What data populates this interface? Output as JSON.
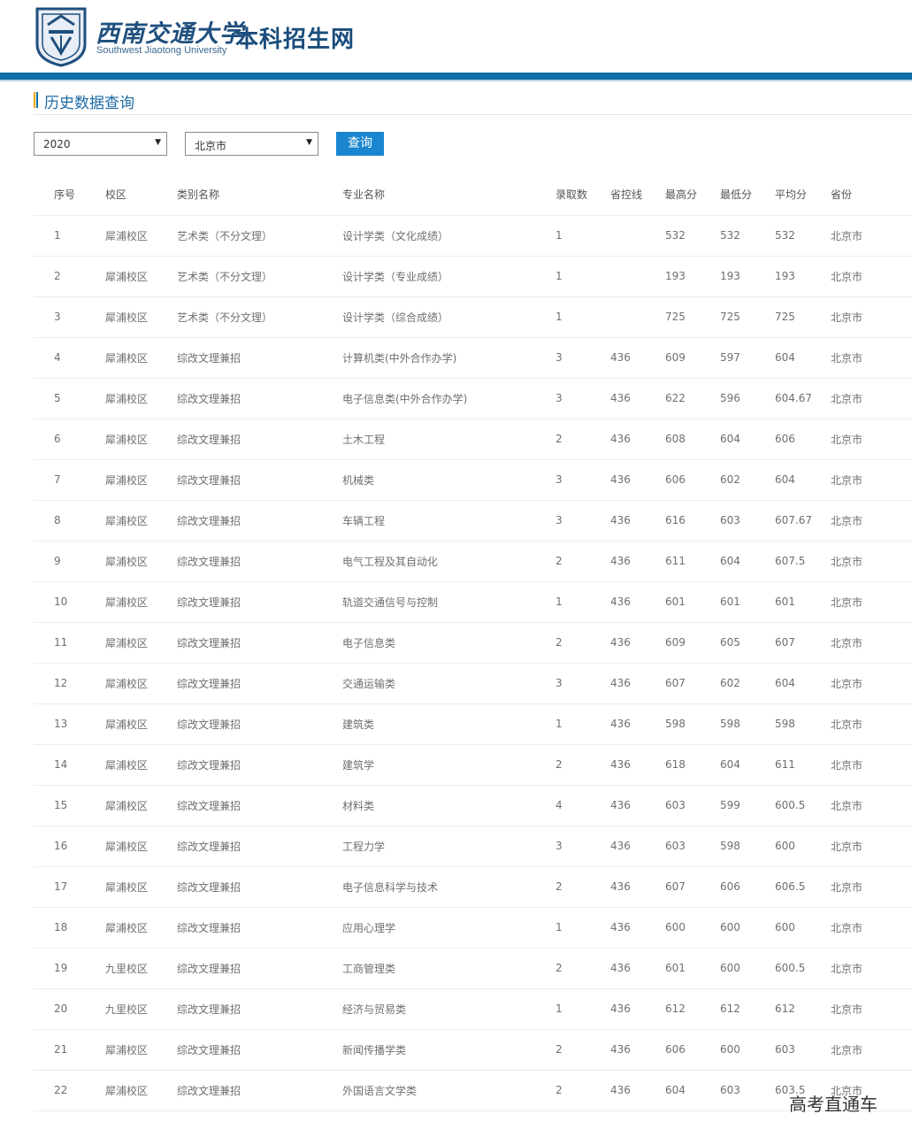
{
  "header": {
    "school_name_cn": "西南交通大学",
    "school_name_en": "Southwest Jiaotong University",
    "site_title": "本科招生网",
    "brand_color": "#0f6fa8"
  },
  "section": {
    "title": "历史数据查询"
  },
  "filters": {
    "year": "2020",
    "province": "北京市",
    "query_label": "查询"
  },
  "table": {
    "headers": [
      "序号",
      "校区",
      "类别名称",
      "专业名称",
      "录取数",
      "省控线",
      "最高分",
      "最低分",
      "平均分",
      "省份"
    ],
    "rows": [
      [
        "1",
        "犀浦校区",
        "艺术类（不分文理）",
        "设计学类（文化成绩）",
        "1",
        "",
        "532",
        "532",
        "532",
        "北京市"
      ],
      [
        "2",
        "犀浦校区",
        "艺术类（不分文理）",
        "设计学类（专业成绩）",
        "1",
        "",
        "193",
        "193",
        "193",
        "北京市"
      ],
      [
        "3",
        "犀浦校区",
        "艺术类（不分文理）",
        "设计学类（综合成绩）",
        "1",
        "",
        "725",
        "725",
        "725",
        "北京市"
      ],
      [
        "4",
        "犀浦校区",
        "综改文理兼招",
        "计算机类(中外合作办学)",
        "3",
        "436",
        "609",
        "597",
        "604",
        "北京市"
      ],
      [
        "5",
        "犀浦校区",
        "综改文理兼招",
        "电子信息类(中外合作办学)",
        "3",
        "436",
        "622",
        "596",
        "604.67",
        "北京市"
      ],
      [
        "6",
        "犀浦校区",
        "综改文理兼招",
        "土木工程",
        "2",
        "436",
        "608",
        "604",
        "606",
        "北京市"
      ],
      [
        "7",
        "犀浦校区",
        "综改文理兼招",
        "机械类",
        "3",
        "436",
        "606",
        "602",
        "604",
        "北京市"
      ],
      [
        "8",
        "犀浦校区",
        "综改文理兼招",
        "车辆工程",
        "3",
        "436",
        "616",
        "603",
        "607.67",
        "北京市"
      ],
      [
        "9",
        "犀浦校区",
        "综改文理兼招",
        "电气工程及其自动化",
        "2",
        "436",
        "611",
        "604",
        "607.5",
        "北京市"
      ],
      [
        "10",
        "犀浦校区",
        "综改文理兼招",
        "轨道交通信号与控制",
        "1",
        "436",
        "601",
        "601",
        "601",
        "北京市"
      ],
      [
        "11",
        "犀浦校区",
        "综改文理兼招",
        "电子信息类",
        "2",
        "436",
        "609",
        "605",
        "607",
        "北京市"
      ],
      [
        "12",
        "犀浦校区",
        "综改文理兼招",
        "交通运输类",
        "3",
        "436",
        "607",
        "602",
        "604",
        "北京市"
      ],
      [
        "13",
        "犀浦校区",
        "综改文理兼招",
        "建筑类",
        "1",
        "436",
        "598",
        "598",
        "598",
        "北京市"
      ],
      [
        "14",
        "犀浦校区",
        "综改文理兼招",
        "建筑学",
        "2",
        "436",
        "618",
        "604",
        "611",
        "北京市"
      ],
      [
        "15",
        "犀浦校区",
        "综改文理兼招",
        "材料类",
        "4",
        "436",
        "603",
        "599",
        "600.5",
        "北京市"
      ],
      [
        "16",
        "犀浦校区",
        "综改文理兼招",
        "工程力学",
        "3",
        "436",
        "603",
        "598",
        "600",
        "北京市"
      ],
      [
        "17",
        "犀浦校区",
        "综改文理兼招",
        "电子信息科学与技术",
        "2",
        "436",
        "607",
        "606",
        "606.5",
        "北京市"
      ],
      [
        "18",
        "犀浦校区",
        "综改文理兼招",
        "应用心理学",
        "1",
        "436",
        "600",
        "600",
        "600",
        "北京市"
      ],
      [
        "19",
        "九里校区",
        "综改文理兼招",
        "工商管理类",
        "2",
        "436",
        "601",
        "600",
        "600.5",
        "北京市"
      ],
      [
        "20",
        "九里校区",
        "综改文理兼招",
        "经济与贸易类",
        "1",
        "436",
        "612",
        "612",
        "612",
        "北京市"
      ],
      [
        "21",
        "犀浦校区",
        "综改文理兼招",
        "新闻传播学类",
        "2",
        "436",
        "606",
        "600",
        "603",
        "北京市"
      ],
      [
        "22",
        "犀浦校区",
        "综改文理兼招",
        "外国语言文学类",
        "2",
        "436",
        "604",
        "603",
        "603.5",
        "北京市"
      ]
    ]
  },
  "watermark": "高考直通车"
}
